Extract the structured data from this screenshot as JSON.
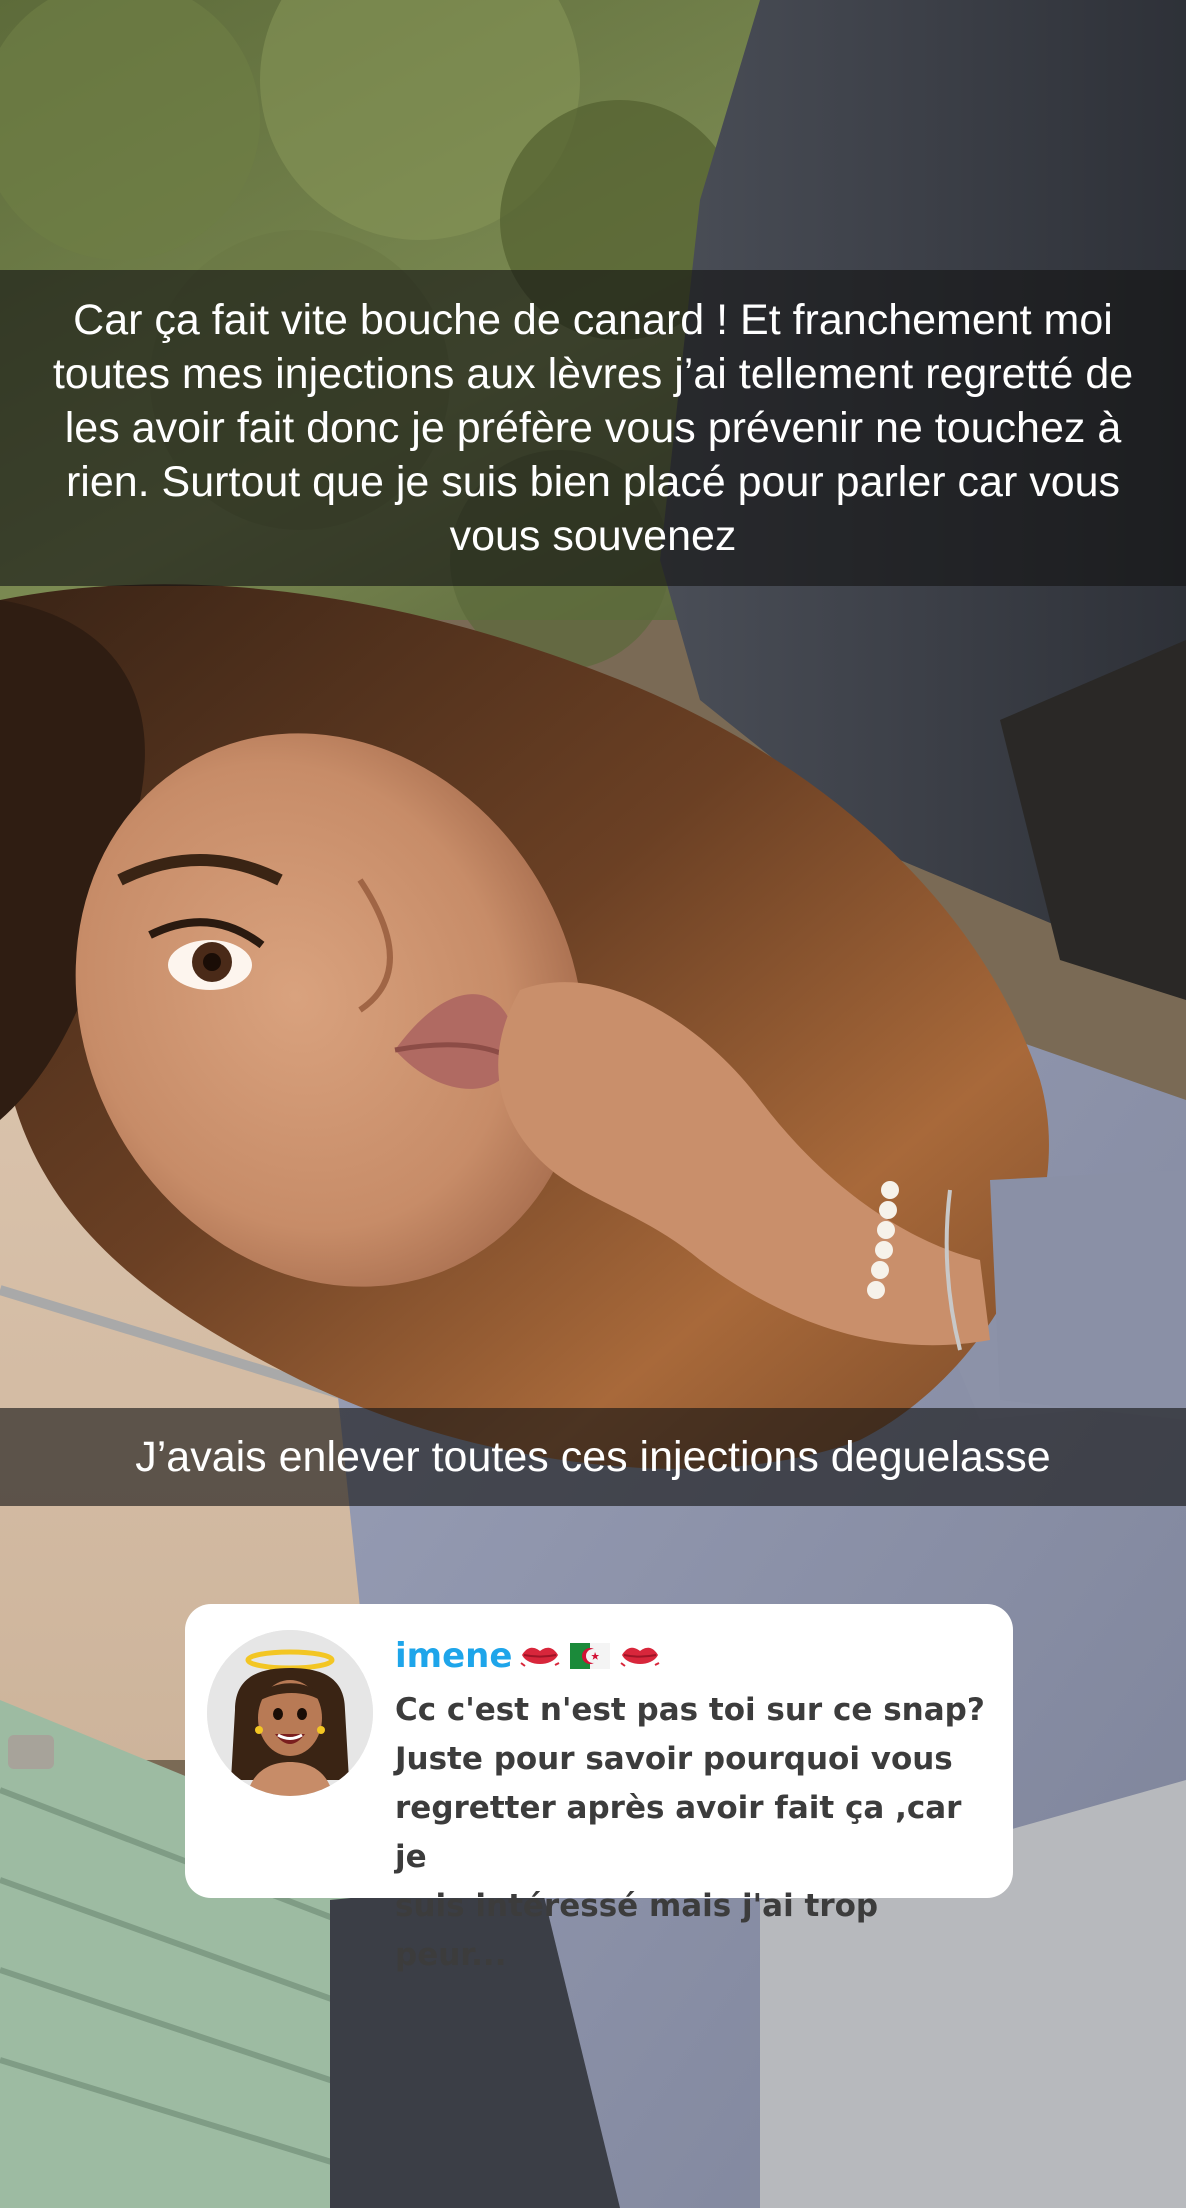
{
  "story": {
    "caption_top": "Car ça fait vite bouche de canard ! Et franchement moi toutes mes injections aux lèvres j’ai tellement regretté de les avoir fait donc je préfère vous prévenir ne touchez à rien. Surtout que je suis bien placé pour parler car vous vous souvenez",
    "caption_bottom": "J’avais enlever toutes ces injections deguelasse"
  },
  "reply": {
    "username": "imene",
    "emojis": [
      "lips-icon",
      "algeria-flag-icon",
      "lips-icon"
    ],
    "message": "Cc c'est n'est pas toi sur ce snap?\nJuste pour savoir pourquoi vous\nregretter après avoir fait ça ,car je\nsuis intéressé mais j'ai trop peur...",
    "name_color": "#1ea5ea"
  }
}
